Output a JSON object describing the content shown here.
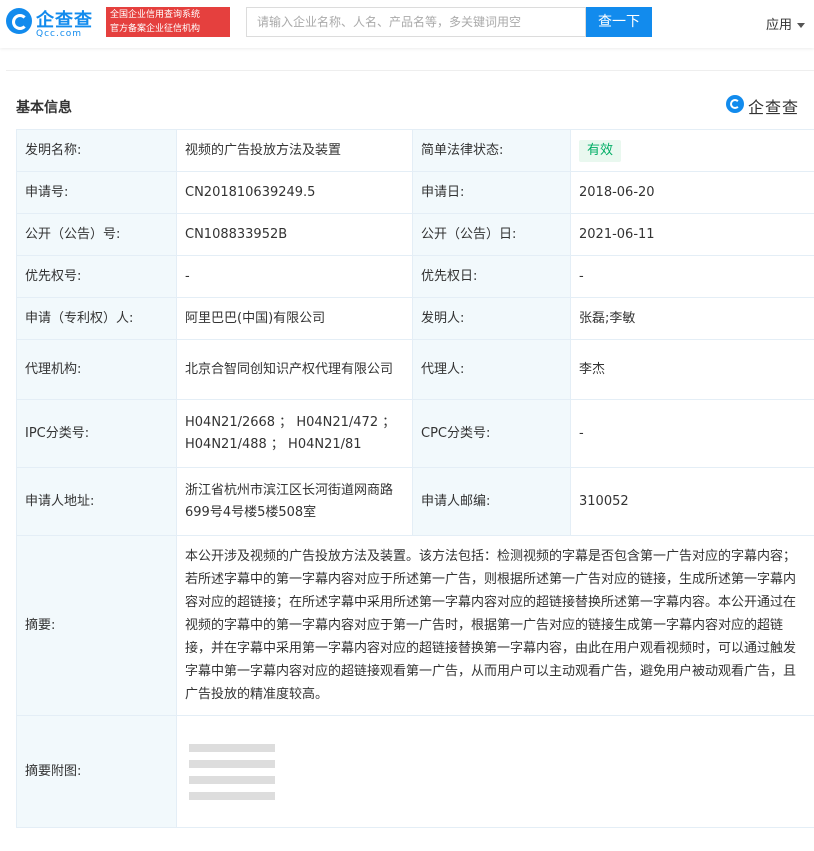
{
  "header": {
    "logo_name": "企查查",
    "logo_domain": "Qcc.com",
    "slogan_line1": "全国企业信用查询系统",
    "slogan_line2": "官方备案企业征信机构",
    "search_placeholder": "请输入企业名称、人名、产品名等，多关键词用空",
    "search_button": "查一下",
    "apps_label": "应用"
  },
  "section": {
    "title": "基本信息",
    "watermark": "企查查"
  },
  "rows": {
    "invention_name_label": "发明名称:",
    "invention_name": "视频的广告投放方法及装置",
    "legal_status_label": "简单法律状态:",
    "legal_status": "有效",
    "app_no_label": "申请号:",
    "app_no": "CN201810639249.5",
    "app_date_label": "申请日:",
    "app_date": "2018-06-20",
    "pub_no_label": "公开（公告）号:",
    "pub_no": "CN108833952B",
    "pub_date_label": "公开（公告）日:",
    "pub_date": "2021-06-11",
    "priority_no_label": "优先权号:",
    "priority_no": "-",
    "priority_date_label": "优先权日:",
    "priority_date": "-",
    "applicant_label": "申请（专利权）人:",
    "applicant": "阿里巴巴(中国)有限公司",
    "inventor_label": "发明人:",
    "inventor": "张磊;李敏",
    "agency_label": "代理机构:",
    "agency": "北京合智同创知识产权代理有限公司",
    "agent_label": "代理人:",
    "agent": "李杰",
    "ipc_label": "IPC分类号:",
    "ipc": "H04N21/2668 ； H04N21/472 ； H04N21/488 ； H04N21/81",
    "cpc_label": "CPC分类号:",
    "cpc": "-",
    "address_label": "申请人地址:",
    "address": "浙江省杭州市滨江区长河街道网商路699号4号楼5楼508室",
    "zip_label": "申请人邮编:",
    "zip": "310052",
    "abstract_label": "摘要:",
    "abstract": "本公开涉及视频的广告投放方法及装置。该方法包括：检测视频的字幕是否包含第一广告对应的字幕内容；若所述字幕中的第一字幕内容对应于所述第一广告，则根据所述第一广告对应的链接，生成所述第一字幕内容对应的超链接；在所述字幕中采用所述第一字幕内容对应的超链接替换所述第一字幕内容。本公开通过在视频的字幕中的第一字幕内容对应于第一广告时，根据第一广告对应的链接生成第一字幕内容对应的超链接，并在字幕中采用第一字幕内容对应的超链接替换第一字幕内容，由此在用户观看视频时，可以通过触发字幕中第一字幕内容对应的超链接观看第一广告，从而用户可以主动观看广告，避免用户被动观看广告，且广告投放的精准度较高。",
    "abstract_image_label": "摘要附图:"
  }
}
